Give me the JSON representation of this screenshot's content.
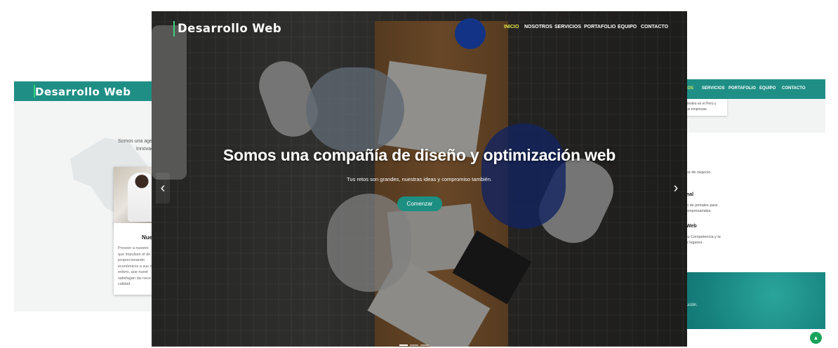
{
  "brand": {
    "name": "Desarrollo Web",
    "accent": "#3ed27e"
  },
  "nav": [
    {
      "label": "INICIO",
      "active": true
    },
    {
      "label": "NOSOTROS"
    },
    {
      "label": "SERVICIOS"
    },
    {
      "label": "PORTAFOLIO"
    },
    {
      "label": "EQUIPO"
    },
    {
      "label": "CONTACTO"
    }
  ],
  "hero": {
    "title": "Somos una compañía de diseño y optimización web",
    "subtitle": "Tus retos son grandes, nuestras ideas y compromiso también.",
    "cta": "Comenzar",
    "prev_icon": "chevron-left-icon",
    "next_icon": "chevron-right-icon",
    "slides": 4,
    "active_slide": 1
  },
  "left_preview": {
    "brand": "Desarrollo Web",
    "intro": [
      "Somos una agen",
      "Innovac"
    ],
    "card": {
      "title": "Nue",
      "lines": [
        "Proveer a nuestro",
        "que impulsen el de",
        "proporcionando",
        "económicos a sus n",
        "entero, que nuest",
        "satisfagan las nece",
        "calidad."
      ]
    }
  },
  "right_preview": {
    "nav": [
      "ROS",
      "SERVICIOS",
      "PORTAFOLIO",
      "EQUIPO",
      "CONTACTO"
    ],
    "chip_lines": [
      "lientes en el Perú y",
      "us empresas."
    ],
    "text1": "os de negocio.",
    "head1": "nal",
    "text2": [
      "o de portales para",
      "empresariales."
    ],
    "head2": "Web",
    "text3": [
      "tu Competencia y te",
      "s lugares."
    ],
    "teal_text": "ución."
  },
  "colors": {
    "primary": "#1f8f86",
    "cta": "#1c8f82",
    "active_nav": "#e7e94a",
    "scroll_top": "#1aa35b"
  }
}
